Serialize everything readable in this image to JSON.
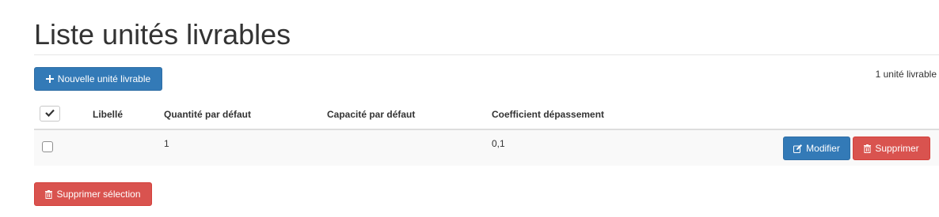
{
  "header": {
    "title": "Liste unités livrables"
  },
  "toolbar": {
    "new_label": "Nouvelle unité livrable",
    "count_text": "1 unité livrable"
  },
  "table": {
    "columns": [
      "Libellé",
      "Quantité par défaut",
      "Capacité par défaut",
      "Coefficient dépassement"
    ],
    "rows": [
      {
        "libelle": "",
        "quantite": "1",
        "capacite": "",
        "coefficient": "0,1",
        "edit_label": "Modifier",
        "delete_label": "Supprimer"
      }
    ]
  },
  "footer": {
    "delete_selection_label": "Supprimer sélection"
  },
  "icons": {
    "plus": "plus-icon",
    "edit": "edit-icon",
    "trash": "trash-icon",
    "check": "check-icon"
  },
  "colors": {
    "primary": "#337ab7",
    "danger": "#d9534f",
    "row_stripe": "#f9f9f9"
  }
}
